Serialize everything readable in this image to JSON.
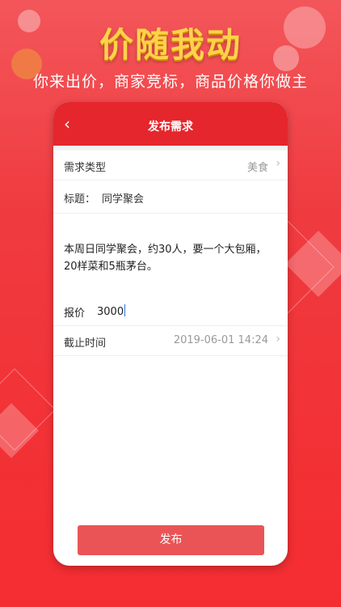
{
  "banner": {
    "slogan": "价随我动",
    "subtitle": "你来出价，商家竞标，商品价格你做主"
  },
  "nav": {
    "back_icon": "chevron-left-icon",
    "title": "发布需求"
  },
  "form": {
    "type_label": "需求类型",
    "type_value": "美食",
    "title_label": "标题：",
    "title_value": "同学聚会",
    "description": "本周日同学聚会，约30人，要一个大包厢，20样菜和5瓶茅台。",
    "price_label": "报价",
    "price_value": "3000",
    "deadline_label": "截止时间",
    "deadline_value": "2019-06-01 14:24",
    "submit_label": "发布"
  },
  "colors": {
    "brand_red": "#e5262c",
    "button_red": "#ea5457",
    "slogan_gold": "#ffd24a"
  }
}
